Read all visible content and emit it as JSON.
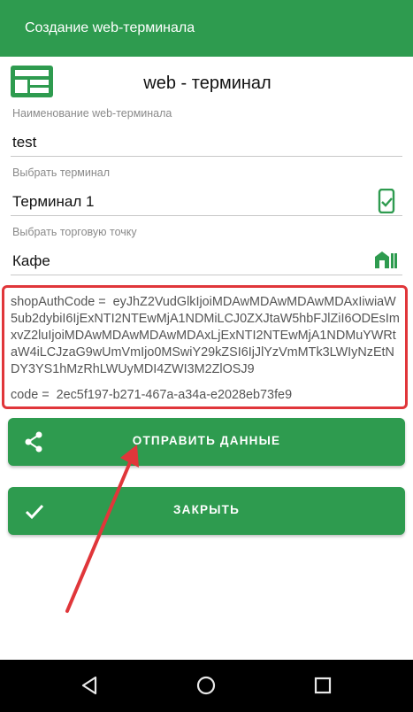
{
  "appbar": {
    "title": "Создание web-терминала"
  },
  "header": {
    "title": "web - терминал",
    "logo_icon": "terminal-logo-icon"
  },
  "fields": {
    "name": {
      "label": "Наименование web-терминала",
      "value": "test"
    },
    "terminal": {
      "label": "Выбрать терминал",
      "value": "Терминал 1",
      "icon": "phone-check-icon"
    },
    "point": {
      "label": "Выбрать торговую точку",
      "value": "Кафе",
      "icon": "shop-icon"
    }
  },
  "codes": {
    "shop_auth_label": "shopAuthCode =",
    "shop_auth_value": "eyJhZ2VudGlkIjoiMDAwMDAwMDAwMDAxIiwiaW5ub2dybiI6IjExNTI2NTEwMjA1NDMiLCJ0ZXJtaW5hbFJlZiI6ODEsImxvZ2luIjoiMDAwMDAwMDAwMDAxLjExNTI2NTEwMjA1NDMuYWRtaW4iLCJzaG9wUmVmIjo0MSwiY29kZSI6IjJlYzVmMTk3LWIyNzEtNDY3YS1hMzRhLWUyMDI4ZWI3M2ZlOSJ9",
    "code_label": "code =",
    "code_value": "2ec5f197-b271-467a-a34a-e2028eb73fe9"
  },
  "buttons": {
    "send": {
      "label": "ОТПРАВИТЬ ДАННЫЕ",
      "icon": "share-icon"
    },
    "close": {
      "label": "ЗАКРЫТЬ",
      "icon": "check-icon"
    }
  },
  "navbar": {
    "back_icon": "back-icon",
    "home_icon": "home-icon",
    "recents_icon": "recents-icon"
  },
  "colors": {
    "primary": "#2e9b4f",
    "highlight": "#e0363a",
    "arrow": "#e0363a"
  }
}
